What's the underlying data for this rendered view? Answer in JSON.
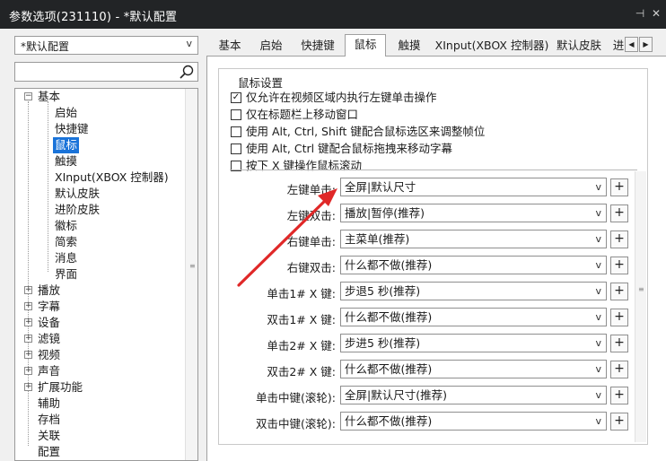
{
  "window": {
    "title": "参数选项(231110) - *默认配置",
    "pin_glyph": "⊣",
    "close_glyph": "✕"
  },
  "profile": {
    "selected": "*默认配置"
  },
  "search": {
    "placeholder": ""
  },
  "tree": {
    "basic": "基本",
    "basic_children": [
      "启始",
      "快捷键",
      "鼠标",
      "触摸",
      "XInput(XBOX 控制器)",
      "默认皮肤",
      "进阶皮肤",
      "徽标",
      "简索",
      "消息",
      "界面"
    ],
    "expandable": [
      "播放",
      "字幕",
      "设备",
      "滤镜",
      "视频",
      "声音",
      "扩展功能"
    ],
    "plain": [
      "辅助",
      "存档",
      "关联",
      "配置"
    ],
    "selected": "鼠标"
  },
  "tabs": [
    "基本",
    "启始",
    "快捷键",
    "鼠标",
    "触摸",
    "XInput(XBOX 控制器)",
    "默认皮肤",
    "进"
  ],
  "active_tab": "鼠标",
  "mouse": {
    "group_title": "鼠标设置",
    "checkboxes": [
      {
        "label": "仅允许在视频区域内执行左键单击操作",
        "checked": true
      },
      {
        "label": "仅在标题栏上移动窗口",
        "checked": false
      },
      {
        "label": "使用 Alt, Ctrl, Shift 键配合鼠标选区来调整帧位",
        "checked": false
      },
      {
        "label": "使用 Alt, Ctrl 键配合鼠标拖拽来移动字幕",
        "checked": false
      },
      {
        "label": "按下 X 键操作鼠标滚动",
        "checked": false
      }
    ],
    "actions": [
      {
        "label": "左键单击:",
        "value": "全屏|默认尺寸"
      },
      {
        "label": "左键双击:",
        "value": "播放|暂停(推荐)"
      },
      {
        "label": "右键单击:",
        "value": "主菜单(推荐)"
      },
      {
        "label": "右键双击:",
        "value": "什么都不做(推荐)"
      },
      {
        "label": "单击1# X 键:",
        "value": "步退5 秒(推荐)"
      },
      {
        "label": "双击1# X 键:",
        "value": "什么都不做(推荐)"
      },
      {
        "label": "单击2# X 键:",
        "value": "步进5 秒(推荐)"
      },
      {
        "label": "双击2# X 键:",
        "value": "什么都不做(推荐)"
      },
      {
        "label": "单击中键(滚轮):",
        "value": "全屏|默认尺寸(推荐)"
      },
      {
        "label": "双击中键(滚轮):",
        "value": "什么都不做(推荐)"
      }
    ],
    "plus_label": "+",
    "dropdown_glyph": "v"
  },
  "annotation": {
    "arrow_color": "#e02828"
  }
}
